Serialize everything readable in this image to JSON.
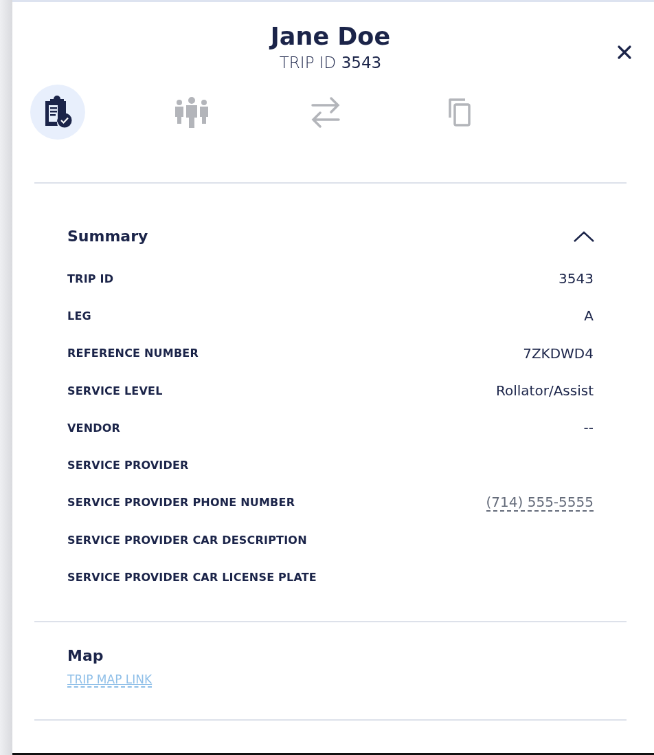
{
  "header": {
    "title": "Jane Doe",
    "subtitle": "TRIP ID **3543**"
  },
  "tabs": [
    {
      "kind": "clipboard",
      "selected": true
    },
    {
      "kind": "people",
      "selected": false
    },
    {
      "kind": "swap",
      "selected": false
    },
    {
      "kind": "copy",
      "selected": false
    }
  ],
  "summary": {
    "title": "Summary",
    "expanded": true,
    "rows": [
      {
        "label": "TRIP ID",
        "value": "3543",
        "kind": "text"
      },
      {
        "label": "LEG",
        "value": "A",
        "kind": "text"
      },
      {
        "label": "REFERENCE NUMBER",
        "value": "7ZKDWD4",
        "kind": "text"
      },
      {
        "label": "SERVICE LEVEL",
        "value": "Rollator/Assist",
        "kind": "text"
      },
      {
        "label": "VENDOR",
        "value": "--",
        "kind": "text"
      },
      {
        "label": "SERVICE PROVIDER"
      },
      {
        "label": "SERVICE PROVIDER PHONE NUMBER",
        "value": "(714) 555-5555",
        "kind": "phone"
      },
      {
        "label": "SERVICE PROVIDER CAR DESCRIPTION"
      },
      {
        "label": "SERVICE PROVIDER CAR LICENSE PLATE"
      }
    ]
  },
  "map": {
    "title": "Map",
    "link": "TRIP MAP LINK"
  }
}
